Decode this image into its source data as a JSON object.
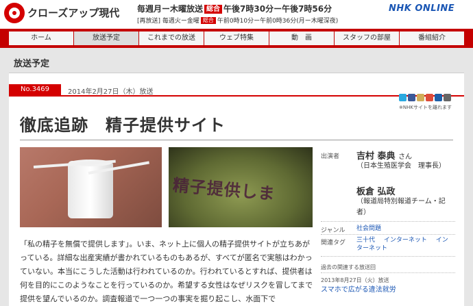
{
  "header": {
    "logo_text": "クローズアップ現代",
    "schedule_main_prefix": "毎週月ー木曜放送",
    "schedule_main_channel": "総合",
    "schedule_main_time": "午後7時30分ー午後7時56分",
    "schedule_re_prefix": "[再放送] 毎週火ー金曜",
    "schedule_re_channel": "総合",
    "schedule_re_time": "午前0時10分ー午前0時36分(月ー木曜深夜)",
    "network": "NHK ONLINE"
  },
  "nav": {
    "items": [
      "ホーム",
      "放送予定",
      "これまでの放送",
      "ウェブ特集",
      "動　画",
      "スタッフの部屋",
      "番組紹介"
    ],
    "active_index": 1
  },
  "page": {
    "heading": "放送予定"
  },
  "episode": {
    "number": "No.3469",
    "air_date": "2014年2月27日（木）放送",
    "title": "徹底追跡　精子提供サイト",
    "photo2_text": "精子提供しま",
    "body": "「私の精子を無償で提供します」。いま、ネット上に個人の精子提供サイトが立ちあがっている。詳細な出産実績が書かれているものもあるが、すべてが匿名で実態はわかっていない。本当にこうした活動は行われているのか。行われているとすれば、提供者は何を目的にこのようなことを行っているのか。希望する女性はなぜリスクを冒してまで提供を望んでいるのか。調査報道で一つ一つの事実を掘り起こし、水面下で"
  },
  "social": {
    "note": "※NHKサイトを離れます",
    "icons": [
      {
        "name": "twitter-icon",
        "color": "#2aa9e0"
      },
      {
        "name": "facebook-icon",
        "color": "#3b5998"
      },
      {
        "name": "mixi-icon",
        "color": "#d1ad59"
      },
      {
        "name": "google-icon",
        "color": "#dd4b39"
      },
      {
        "name": "bookmark-icon",
        "color": "#1d5fa8"
      },
      {
        "name": "help-icon",
        "color": "#666666"
      }
    ]
  },
  "sidebar": {
    "guests_label": "出演者",
    "guests": [
      {
        "name": "吉村 泰典",
        "honorific": "さん",
        "affiliation": "（日本生殖医学会　理事長）"
      },
      {
        "name": "板倉 弘政",
        "honorific": "",
        "affiliation": "（報道局特別報道チーム・記者）"
      }
    ],
    "genre_label": "ジャンル",
    "genre": "社会問題",
    "tags_label": "関連タグ",
    "tags": [
      "三十代",
      "インターネット",
      "インターネット"
    ],
    "past_heading": "過去の関連する放送回",
    "past_date": "2013年8月27日（火）放送",
    "past_title": "スマホで広がる違法就労"
  }
}
